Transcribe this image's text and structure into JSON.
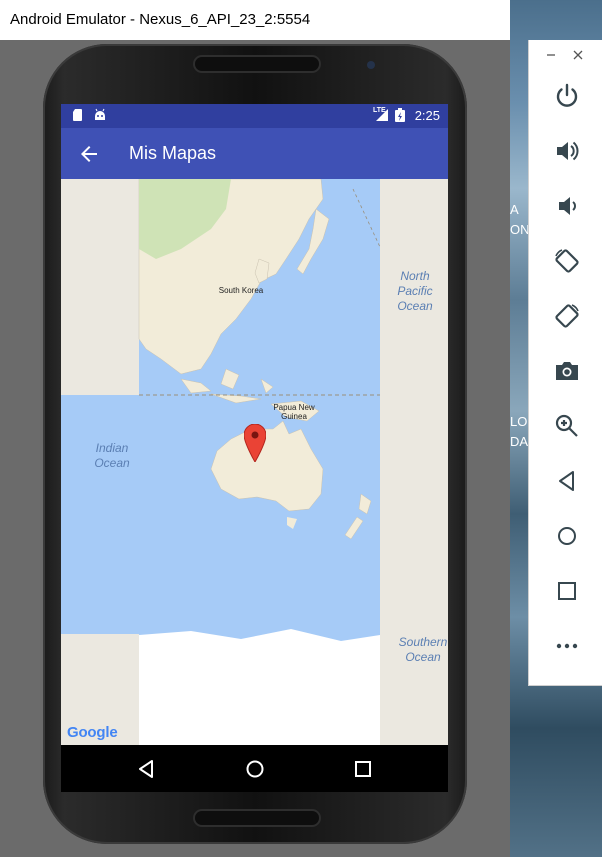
{
  "window": {
    "title": "Android Emulator - Nexus_6_API_23_2:5554"
  },
  "status_bar": {
    "time": "2:25",
    "network": "LTE"
  },
  "app_bar": {
    "title": "Mis Mapas"
  },
  "map": {
    "labels": {
      "north_pacific": "North\nPacific\nOcean",
      "indian_ocean": "Indian\nOcean",
      "southern_ocean": "Southern\nOcean",
      "south_korea": "South Korea",
      "papua_new_guinea": "Papua New\nGuinea"
    },
    "attribution": "Google"
  },
  "desktop": {
    "fragments": [
      "A",
      "ON",
      "LO",
      "DA"
    ]
  },
  "colors": {
    "status_bar": "#303f9f",
    "app_bar": "#3f51b5",
    "ocean": "#a6cbf7",
    "land": "#f2ecd9",
    "marker": "#ea4335"
  }
}
